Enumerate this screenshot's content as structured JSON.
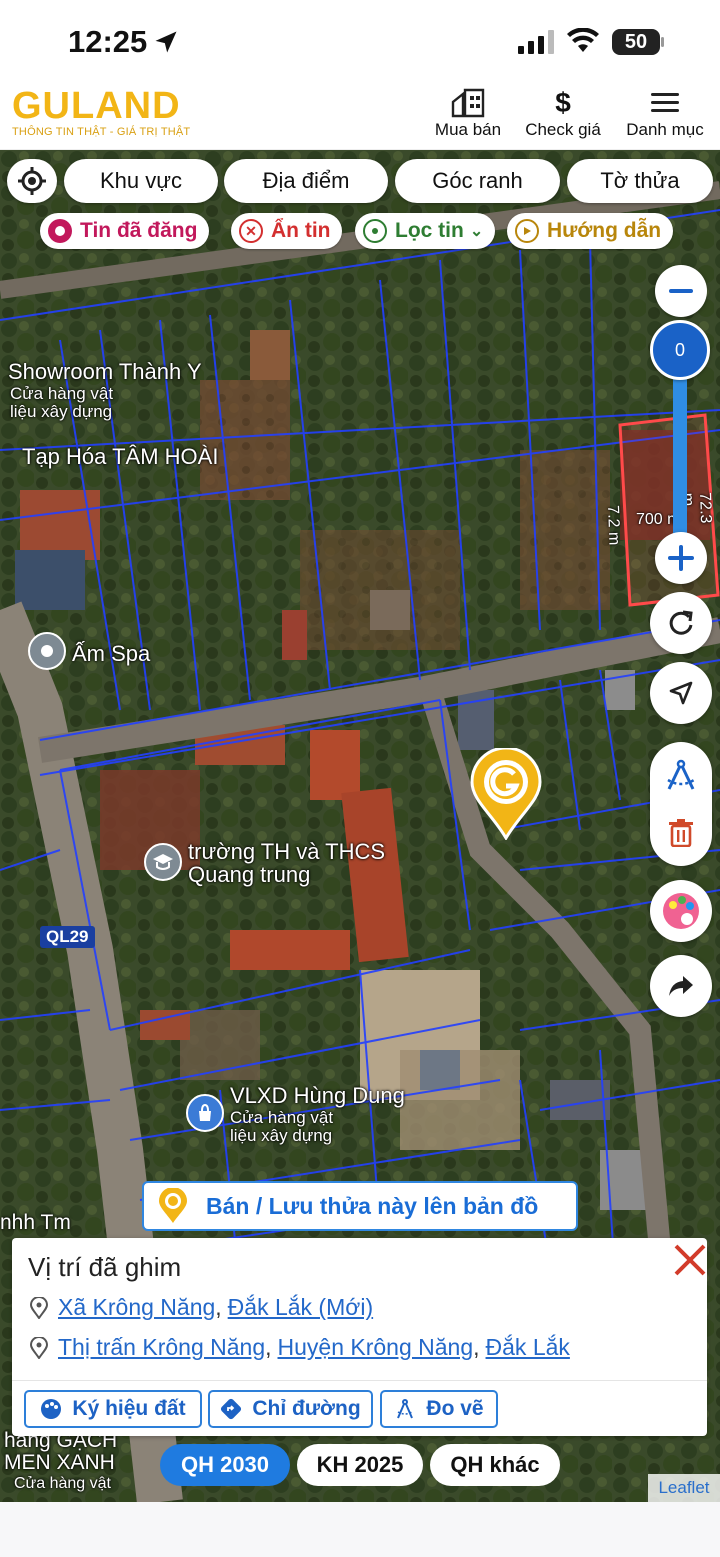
{
  "status_bar": {
    "time": "12:25",
    "battery": "50"
  },
  "header": {
    "logo_text": "GULAND",
    "logo_tagline": "THÔNG TIN THẬT - GIÁ TRỊ THẬT",
    "nav": [
      {
        "label": "Mua bán",
        "icon": "buildings-icon"
      },
      {
        "label": "Check giá",
        "icon": "dollar-icon"
      },
      {
        "label": "Danh mục",
        "icon": "menu-icon"
      }
    ]
  },
  "filters": {
    "primary": [
      "Khu vực",
      "Địa điểm",
      "Góc ranh",
      "Tờ thửa"
    ],
    "secondary": [
      {
        "label": "Tin đã đăng",
        "color": "#c2185b"
      },
      {
        "label": "Ẩn tin",
        "color": "#d32f2f"
      },
      {
        "label": "Lọc tin",
        "color": "#2e7d32"
      },
      {
        "label": "Hướng dẫn",
        "color": "#b8860b"
      }
    ]
  },
  "map": {
    "zoom_value": "0",
    "labels": {
      "showroom": "Showroom Thành Y",
      "showroom_sub": "Cửa hàng vật liệu xây dựng",
      "taphoa": "Tạp Hóa TÂM HOÀI",
      "amspa": "Ấm Spa",
      "school": "trường TH và THCS Quang trung",
      "road": "QL29",
      "vlxd": "VLXD Hùng Dung",
      "vlxd_sub": "Cửa hàng vật liệu xây dựng",
      "nhhtm": "nhh Tm",
      "gach": "hàng GẠCH MEN XANH",
      "gach_sub": "Cửa hàng vật",
      "dim_a": "7.2 m",
      "dim_b": "72.3 m",
      "dim_c": "700 m²"
    },
    "attribution": "Leaflet"
  },
  "save_banner": "Bán / Lưu thửa này lên bản đồ",
  "card": {
    "title": "Vị trí đã ghim",
    "line1": [
      "Xã Krông Năng",
      "Đắk Lắk (Mới)"
    ],
    "line2": [
      "Thị trấn Krông Năng",
      "Huyện Krông Năng",
      "Đắk Lắk"
    ],
    "buttons": [
      "Ký hiệu đất",
      "Chỉ đường",
      "Đo vẽ"
    ]
  },
  "plans": [
    "QH 2030",
    "KH 2025",
    "QH khác"
  ]
}
